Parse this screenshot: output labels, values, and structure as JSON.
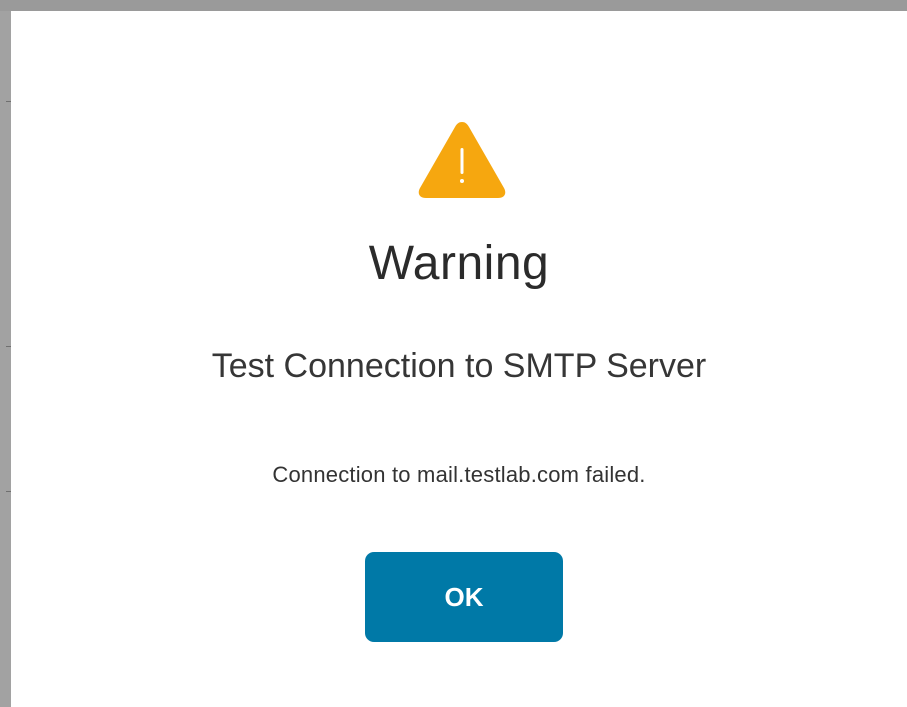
{
  "dialog": {
    "icon": "warning-triangle-icon",
    "title": "Warning",
    "subtitle": "Test Connection to SMTP Server",
    "message": "Connection to mail.testlab.com failed.",
    "ok_label": "OK"
  },
  "colors": {
    "icon_fill": "#F6A70F",
    "button_bg": "#0079A7",
    "button_text": "#FFFFFF",
    "text_primary": "#2B2B2B"
  }
}
